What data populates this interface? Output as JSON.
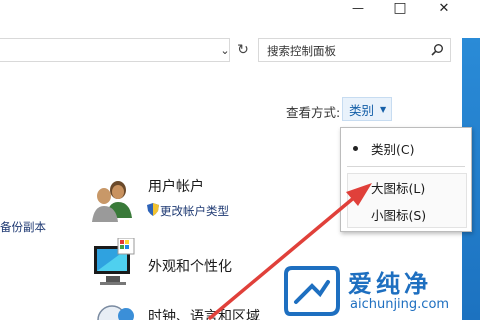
{
  "window": {
    "minimize_glyph": "—",
    "restore_glyph": "□",
    "close_glyph": "✕"
  },
  "address": {
    "dropdown_glyph": "⌄",
    "refresh_glyph": "↻"
  },
  "search": {
    "placeholder": "搜索控制面板",
    "icon": "search-icon"
  },
  "view_by": {
    "label": "查看方式:",
    "value": "类别",
    "caret": "▼",
    "options": [
      {
        "label": "类别(C)",
        "selected": true
      },
      {
        "label": "大图标(L)",
        "selected": false
      },
      {
        "label": "小图标(S)",
        "selected": false
      }
    ]
  },
  "categories": [
    {
      "title": "用户帐户",
      "icon": "users-icon",
      "links": [
        "更改帐户类型"
      ]
    },
    {
      "title": "外观和个性化",
      "icon": "display-icon",
      "links": []
    },
    {
      "title": "时钟、语言和区域",
      "icon": "clock-icon",
      "links": []
    }
  ],
  "left_column": {
    "partial_link": "备份副本"
  },
  "watermark": {
    "brand_cn": "爱纯净",
    "brand_en": "aichunjing.com"
  },
  "colors": {
    "accent": "#1e6fc0",
    "arrow": "#e0403a",
    "scrollbar": "#2a8bd7",
    "link": "#1f3a73"
  }
}
